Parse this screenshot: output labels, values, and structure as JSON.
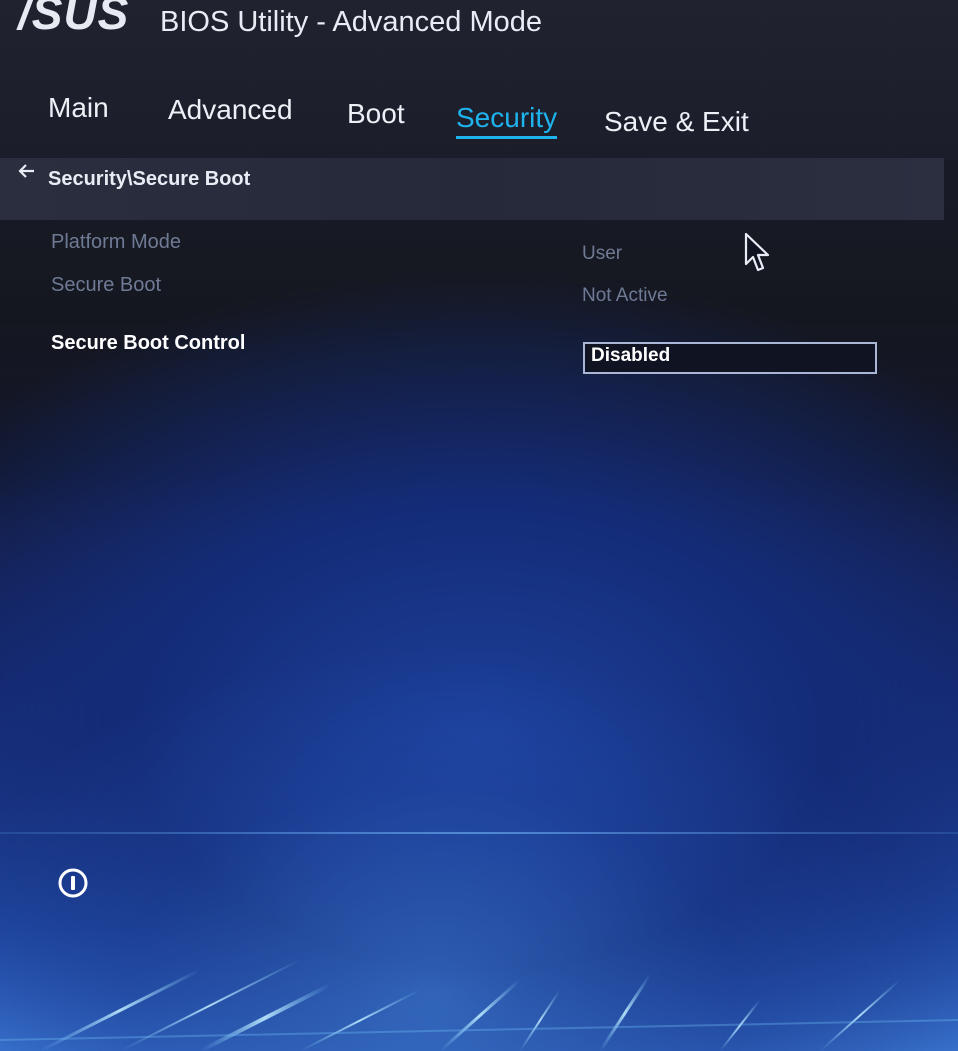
{
  "header": {
    "logo_text": "/SUS",
    "title": "BIOS Utility - Advanced Mode"
  },
  "tabs": [
    {
      "label": "Main",
      "active": false
    },
    {
      "label": "Advanced",
      "active": false
    },
    {
      "label": "Boot",
      "active": false
    },
    {
      "label": "Security",
      "active": true
    },
    {
      "label": "Save & Exit",
      "active": false
    }
  ],
  "breadcrumb": {
    "path": "Security\\Secure Boot"
  },
  "settings": {
    "platform_mode": {
      "label": "Platform Mode",
      "value": "User"
    },
    "secure_boot": {
      "label": "Secure Boot",
      "value": "Not Active"
    },
    "secure_boot_control": {
      "label": "Secure Boot Control",
      "value": "Disabled"
    }
  },
  "icons": {
    "back": "back-arrow-icon",
    "info": "info-icon",
    "cursor": "mouse-pointer-icon"
  },
  "colors": {
    "accent": "#1fb3ee",
    "header_bg": "#1b1e2a",
    "breadcrumb_bg": "#262a3a",
    "dim_text": "#6f7a94"
  }
}
